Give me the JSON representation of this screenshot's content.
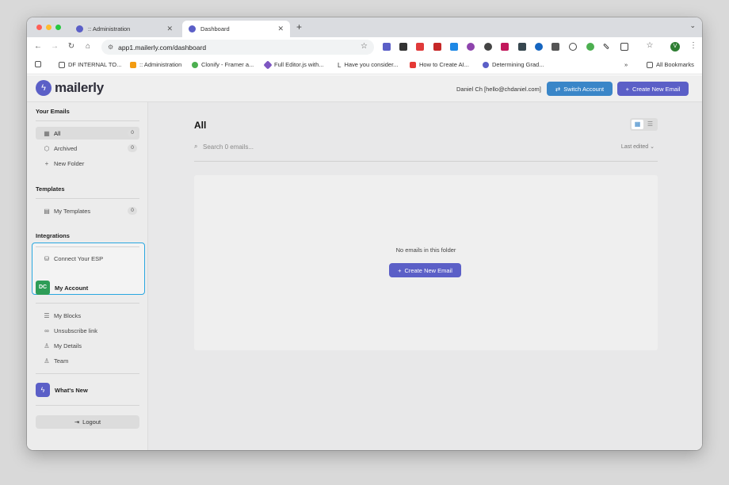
{
  "browser": {
    "tabs": [
      {
        "title": ":: Administration",
        "active": false
      },
      {
        "title": "Dashboard",
        "active": true
      }
    ],
    "url": "app1.mailerly.com/dashboard",
    "profile_initial": "V",
    "bookmarks": [
      {
        "label": "DF INTERNAL TO...",
        "icon": "folder-icon"
      },
      {
        "label": ":: Administration",
        "icon": "heart-icon"
      },
      {
        "label": "Clonify - Framer a...",
        "icon": "globe-icon"
      },
      {
        "label": "Full Editor.js with...",
        "icon": "diamond-icon"
      },
      {
        "label": "Have you consider...",
        "icon": "letter-l-icon"
      },
      {
        "label": "How to Create AI...",
        "icon": "youtube-icon"
      },
      {
        "label": "Determining Grad...",
        "icon": "gear-icon"
      }
    ],
    "all_bookmarks_label": "All Bookmarks"
  },
  "app": {
    "brand": "mailerly",
    "user_label": "Daniel Ch [hello@chdaniel.com]",
    "switch_account_label": "Switch Account",
    "create_new_email_label": "Create New Email"
  },
  "sidebar": {
    "your_emails_title": "Your Emails",
    "items": [
      {
        "label": "All",
        "count": "0"
      },
      {
        "label": "Archived",
        "count": "0"
      },
      {
        "label": "New Folder"
      }
    ],
    "templates_title": "Templates",
    "my_templates": {
      "label": "My Templates",
      "count": "0"
    },
    "integrations_title": "Integrations",
    "connect_esp_label": "Connect Your ESP",
    "account_initials": "DC",
    "my_account_label": "My Account",
    "account_items": [
      {
        "label": "My Blocks"
      },
      {
        "label": "Unsubscribe link"
      },
      {
        "label": "My Details"
      },
      {
        "label": "Team"
      }
    ],
    "whats_new_label": "What's New",
    "logout_label": "Logout"
  },
  "main": {
    "title": "All",
    "search_placeholder": "Search 0 emails...",
    "sort_label": "Last edited",
    "empty_text": "No emails in this folder",
    "create_button_label": "Create New Email"
  },
  "colors": {
    "brand": "#5b5fc7",
    "accent_blue": "#3a86c8",
    "highlight_border": "#2aa7e0",
    "account_badge": "#2e9d57"
  }
}
